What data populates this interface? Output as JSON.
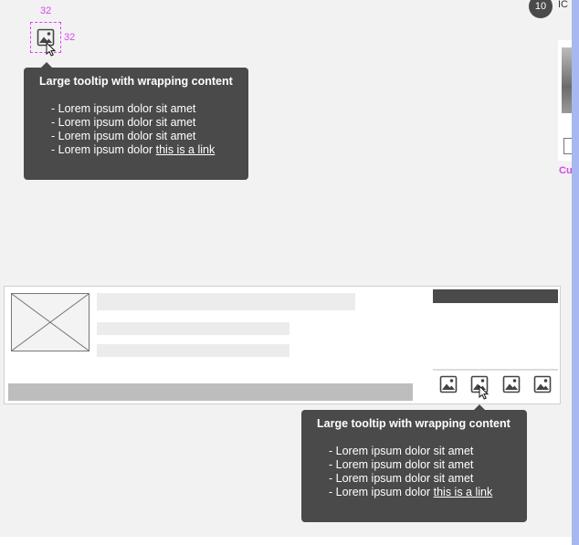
{
  "header": {
    "avatar_text": "10",
    "side_text": "IC"
  },
  "side_card": {
    "label": "Cu"
  },
  "measure": {
    "width_label": "32",
    "height_label": "32"
  },
  "tooltip_top": {
    "title": "Large tooltip with wrapping content",
    "items": [
      "- Lorem ipsum dolor sit amet",
      "- Lorem ipsum dolor sit amet",
      "- Lorem ipsum dolor sit amet"
    ],
    "last_prefix": "- Lorem ipsum dolor ",
    "link": "this is a link"
  },
  "tooltip_bottom": {
    "title": "Large tooltip with wrapping content",
    "items": [
      "- Lorem ipsum dolor sit amet",
      "- Lorem ipsum dolor sit amet",
      "- Lorem ipsum dolor sit amet"
    ],
    "last_prefix": "- Lorem ipsum dolor ",
    "link": "this is a link"
  },
  "card": {
    "action_icons": [
      "image-icon",
      "image-icon",
      "image-icon",
      "image-icon"
    ]
  },
  "colors": {
    "tooltip_bg": "#4a4a4a",
    "measure": "#d946ef",
    "scrollbar": "#a7b8f0"
  }
}
